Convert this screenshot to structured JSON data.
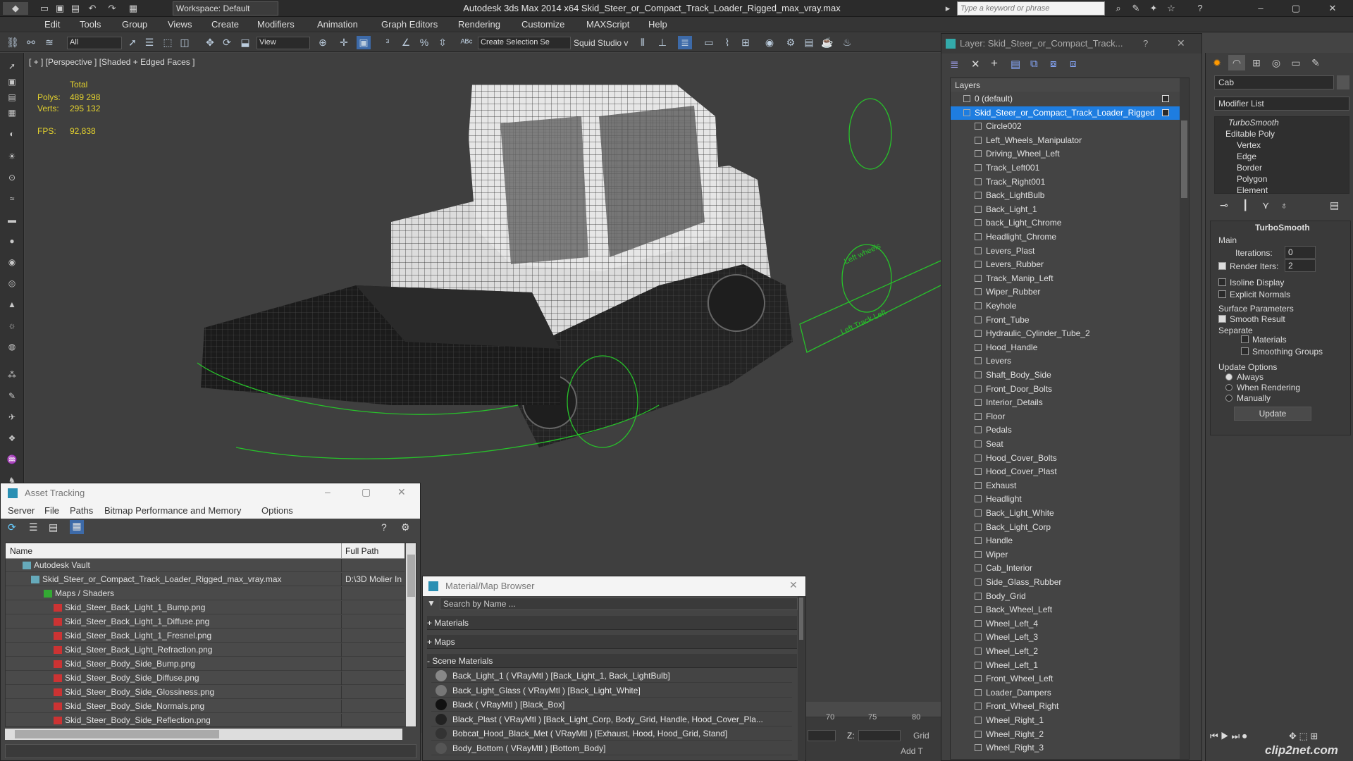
{
  "app": {
    "title": "Autodesk 3ds Max  2014 x64    Skid_Steer_or_Compact_Track_Loader_Rigged_max_vray.max",
    "workspace": "Workspace: Default",
    "search_placeholder": "Type a keyword or phrase"
  },
  "menu": [
    "Edit",
    "Tools",
    "Group",
    "Views",
    "Create",
    "Modifiers",
    "Animation",
    "Graph Editors",
    "Rendering",
    "Customize",
    "MAXScript",
    "Help"
  ],
  "toolbar": {
    "selection_filter": "All",
    "reference_coord": "View",
    "named_selection": "Create Selection Se",
    "squid": "Squid Studio v"
  },
  "viewport": {
    "label": "[ + ] [Perspective ] [Shaded + Edged Faces ]",
    "stats_header": "Total",
    "polys_label": "Polys:",
    "polys_value": "489 298",
    "verts_label": "Verts:",
    "verts_value": "295 132",
    "fps_label": "FPS:",
    "fps_value": "92,838",
    "wheel_label_1": "Left wheels",
    "wheel_label_2": "Left Track Left"
  },
  "layer_panel": {
    "title": "Layer: Skid_Steer_or_Compact_Track...",
    "help": "?",
    "header": "Layers",
    "layers": [
      {
        "name": "0 (default)",
        "indent": 0
      },
      {
        "name": "Skid_Steer_or_Compact_Track_Loader_Rigged",
        "indent": 0,
        "selected": true
      },
      {
        "name": "Circle002",
        "indent": 1
      },
      {
        "name": "Left_Wheels_Manipulator",
        "indent": 1
      },
      {
        "name": "Driving_Wheel_Left",
        "indent": 1
      },
      {
        "name": "Track_Left001",
        "indent": 1
      },
      {
        "name": "Track_Right001",
        "indent": 1
      },
      {
        "name": "Back_LightBulb",
        "indent": 1
      },
      {
        "name": "Back_Light_1",
        "indent": 1
      },
      {
        "name": "back_Light_Chrome",
        "indent": 1
      },
      {
        "name": "Headlight_Chrome",
        "indent": 1
      },
      {
        "name": "Levers_Plast",
        "indent": 1
      },
      {
        "name": "Levers_Rubber",
        "indent": 1
      },
      {
        "name": "Track_Manip_Left",
        "indent": 1
      },
      {
        "name": "Wiper_Rubber",
        "indent": 1
      },
      {
        "name": "Keyhole",
        "indent": 1
      },
      {
        "name": "Front_Tube",
        "indent": 1
      },
      {
        "name": "Hydraulic_Cylinder_Tube_2",
        "indent": 1
      },
      {
        "name": "Hood_Handle",
        "indent": 1
      },
      {
        "name": "Levers",
        "indent": 1
      },
      {
        "name": "Shaft_Body_Side",
        "indent": 1
      },
      {
        "name": "Front_Door_Bolts",
        "indent": 1
      },
      {
        "name": "Interior_Details",
        "indent": 1
      },
      {
        "name": "Floor",
        "indent": 1
      },
      {
        "name": "Pedals",
        "indent": 1
      },
      {
        "name": "Seat",
        "indent": 1
      },
      {
        "name": "Hood_Cover_Bolts",
        "indent": 1
      },
      {
        "name": "Hood_Cover_Plast",
        "indent": 1
      },
      {
        "name": "Exhaust",
        "indent": 1
      },
      {
        "name": "Headlight",
        "indent": 1
      },
      {
        "name": "Back_Light_White",
        "indent": 1
      },
      {
        "name": "Back_Light_Corp",
        "indent": 1
      },
      {
        "name": "Handle",
        "indent": 1
      },
      {
        "name": "Wiper",
        "indent": 1
      },
      {
        "name": "Cab_Interior",
        "indent": 1
      },
      {
        "name": "Side_Glass_Rubber",
        "indent": 1
      },
      {
        "name": "Body_Grid",
        "indent": 1
      },
      {
        "name": "Back_Wheel_Left",
        "indent": 1
      },
      {
        "name": "Wheel_Left_4",
        "indent": 1
      },
      {
        "name": "Wheel_Left_3",
        "indent": 1
      },
      {
        "name": "Wheel_Left_2",
        "indent": 1
      },
      {
        "name": "Wheel_Left_1",
        "indent": 1
      },
      {
        "name": "Front_Wheel_Left",
        "indent": 1
      },
      {
        "name": "Loader_Dampers",
        "indent": 1
      },
      {
        "name": "Front_Wheel_Right",
        "indent": 1
      },
      {
        "name": "Wheel_Right_1",
        "indent": 1
      },
      {
        "name": "Wheel_Right_2",
        "indent": 1
      },
      {
        "name": "Wheel_Right_3",
        "indent": 1
      }
    ]
  },
  "command_panel": {
    "object_name": "Cab",
    "modifier_list": "Modifier List",
    "stack": [
      "TurboSmooth",
      "Editable Poly",
      "Vertex",
      "Edge",
      "Border",
      "Polygon",
      "Element"
    ],
    "rollout_title": "TurboSmooth",
    "main_label": "Main",
    "iterations_label": "Iterations:",
    "iterations_value": "0",
    "render_iters_label": "Render Iters:",
    "render_iters_value": "2",
    "isoline": "Isoline Display",
    "explicit_normals": "Explicit Normals",
    "surface_params": "Surface Parameters",
    "smooth_result": "Smooth Result",
    "separate": "Separate",
    "materials": "Materials",
    "smoothing_groups": "Smoothing Groups",
    "update_options": "Update Options",
    "always": "Always",
    "when_rendering": "When Rendering",
    "manually": "Manually",
    "update_button": "Update"
  },
  "asset_tracking": {
    "title": "Asset Tracking",
    "menu": [
      "Server",
      "File",
      "Paths",
      "Bitmap Performance and Memory",
      "Options"
    ],
    "col_name": "Name",
    "col_path": "Full Path",
    "rows": [
      {
        "name": "Autodesk Vault",
        "path": "",
        "indent": 0
      },
      {
        "name": "Skid_Steer_or_Compact_Track_Loader_Rigged_max_vray.max",
        "path": "D:\\3D Molier In",
        "indent": 1
      },
      {
        "name": "Maps / Shaders",
        "path": "",
        "indent": 2
      },
      {
        "name": "Skid_Steer_Back_Light_1_Bump.png",
        "path": "",
        "indent": 3
      },
      {
        "name": "Skid_Steer_Back_Light_1_Diffuse.png",
        "path": "",
        "indent": 3
      },
      {
        "name": "Skid_Steer_Back_Light_1_Fresnel.png",
        "path": "",
        "indent": 3
      },
      {
        "name": "Skid_Steer_Back_Light_Refraction.png",
        "path": "",
        "indent": 3
      },
      {
        "name": "Skid_Steer_Body_Side_Bump.png",
        "path": "",
        "indent": 3
      },
      {
        "name": "Skid_Steer_Body_Side_Diffuse.png",
        "path": "",
        "indent": 3
      },
      {
        "name": "Skid_Steer_Body_Side_Glossiness.png",
        "path": "",
        "indent": 3
      },
      {
        "name": "Skid_Steer_Body_Side_Normals.png",
        "path": "",
        "indent": 3
      },
      {
        "name": "Skid_Steer_Body_Side_Reflection.png",
        "path": "",
        "indent": 3
      }
    ]
  },
  "material_browser": {
    "title": "Material/Map Browser",
    "search_placeholder": "Search by Name ...",
    "groups": [
      "+ Materials",
      "+ Maps",
      "- Scene Materials"
    ],
    "materials": [
      {
        "label": "Back_Light_1  ( VRayMtl )  [Back_Light_1, Back_LightBulb]",
        "swatch": "#888888"
      },
      {
        "label": "Back_Light_Glass  ( VRayMtl )  [Back_Light_White]",
        "swatch": "#777777"
      },
      {
        "label": "Black  ( VRayMtl )  [Black_Box]",
        "swatch": "#111111"
      },
      {
        "label": "Black_Plast  ( VRayMtl )  [Back_Light_Corp, Body_Grid, Handle, Hood_Cover_Pla...",
        "swatch": "#222222"
      },
      {
        "label": "Bobcat_Hood_Black_Met  ( VRayMtl )  [Exhaust, Hood, Hood_Grid, Stand]",
        "swatch": "#333333"
      },
      {
        "label": "Body_Bottom  ( VRayMtl )  [Bottom_Body]",
        "swatch": "#555555"
      }
    ]
  },
  "timeline": {
    "tick_70": "70",
    "tick_75": "75",
    "tick_80": "80",
    "z_label": "Z:",
    "grid_label": "Grid",
    "add_label": "Add T"
  },
  "watermark": "clip2net.com",
  "colors": {
    "selection": "#1e7de0",
    "stats_yellow": "#e2d02e",
    "manipulator_green": "#27c22a"
  }
}
